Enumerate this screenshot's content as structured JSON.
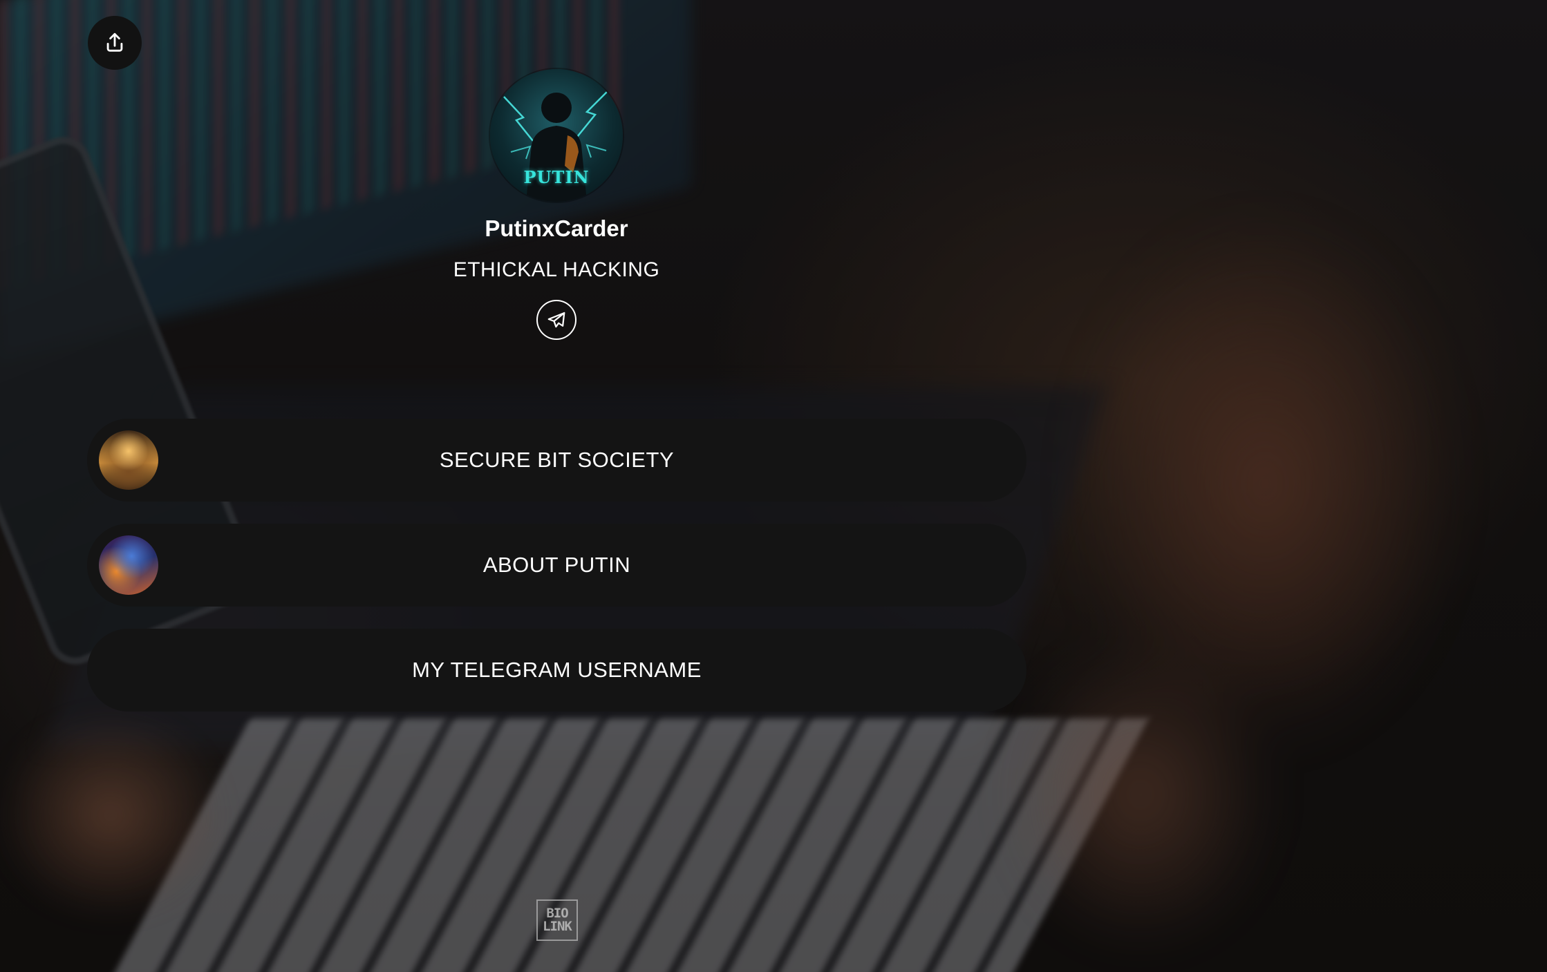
{
  "profile": {
    "avatar_badge_text": "PUTIN",
    "name": "PutinxCarder",
    "bio": "ETHICKAL HACKING"
  },
  "icons": {
    "share": "share-icon",
    "social": "telegram-icon"
  },
  "links": [
    {
      "label": "SECURE BIT SOCIETY",
      "thumbnail": "deity-avatar-gold"
    },
    {
      "label": "ABOUT PUTIN",
      "thumbnail": "deity-avatar-blue"
    },
    {
      "label": "MY TELEGRAM USERNAME",
      "thumbnail": ""
    }
  ],
  "footer": {
    "logo_line1": "BIO",
    "logo_line2": "LINK"
  },
  "colors": {
    "link_background": "#141414",
    "text": "#ffffff",
    "avatar_badge": "#37e4dc"
  }
}
